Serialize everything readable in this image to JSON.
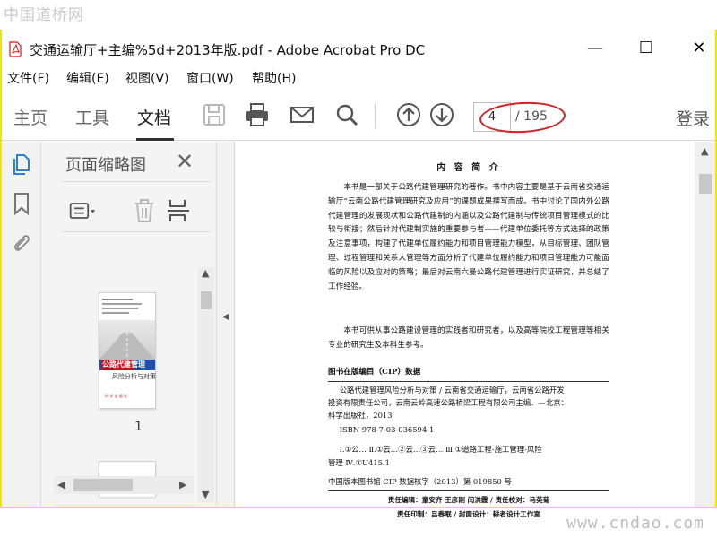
{
  "watermark": {
    "top": "中国道桥网",
    "bottom": "www.cndao.com"
  },
  "window": {
    "title": "交通运输厅+主编%5d+2013年版.pdf - Adobe Acrobat Pro DC",
    "minimize": "—",
    "maximize": "☐",
    "close": "✕"
  },
  "menu": [
    "文件(F)",
    "编辑(E)",
    "视图(V)",
    "窗口(W)",
    "帮助(H)"
  ],
  "toolbar": {
    "tabs": [
      "主页",
      "工具",
      "文档"
    ],
    "active_tab": "文档",
    "icons": [
      "save-icon",
      "print-icon",
      "email-icon",
      "search-icon",
      "page-up-icon",
      "page-down-icon"
    ],
    "current_page": "4",
    "page_total": "/ 195",
    "login": "登录",
    "annotation_color": "#d42020"
  },
  "thumbnails": {
    "title": "页面缩略图",
    "close": "✕",
    "page1_number": "1",
    "cover": {
      "title": "公路代建管理",
      "subtitle": "风险分析与对策",
      "publisher_mark": "科 学 出 版 社"
    }
  },
  "document": {
    "heading": "内 容 简 介",
    "para1": "本书是一部关于公路代建管理研究的著作。书中内容主要是基于云南省交通运输厅“云南公路代建管理研究及应用”的课题成果撰写而成。书中讨论了国内外公路代建管理的发展现状和公路代建制的内涵以及公路代建制与传统项目管理模式的比较与衔接；然后针对代建制实施的重要参与者——代建单位委托等方式选择的政策及注意事项，构建了代建单位履约能力和项目管理能力模型，从目标管理、团队管理、过程管理和关系人管理等方面分析了代建单位履约能力和项目管理能力可能面临的风险以及应对的策略；最后对云南六曼公路代建管理进行实证研究，并总结了工作经验。",
    "para2": "本书可供从事公路建设管理的实践者和研究者，以及高等院校工程管理等相关专业的研究生及本科生参考。",
    "cip_title": "图书在版编目（CIP）数据",
    "cip_lines": [
      "公路代建管理风险分析与对策 / 云南省交通运输厅，云南省公路开发",
      "投资有限责任公司，云南云岭高速公路桥梁工程有限公司主编．—北京：",
      "科学出版社，2013",
      "ISBN 978-7-03-036594-1",
      "Ⅰ.①公…  Ⅱ.①云…②云…③云…  Ⅲ.①道路工程-施工管理-风险",
      "管理  Ⅳ.①U415.1"
    ],
    "cip_number": "中国版本图书馆 CIP 数据核字（2013）第 019850 号",
    "credits1": "责任编辑：童安齐   王彦刚   闫洪霞 / 责任校对：马英菊",
    "credits2": "责任印制：吕春眠 / 封面设计：耕者设计工作室"
  }
}
